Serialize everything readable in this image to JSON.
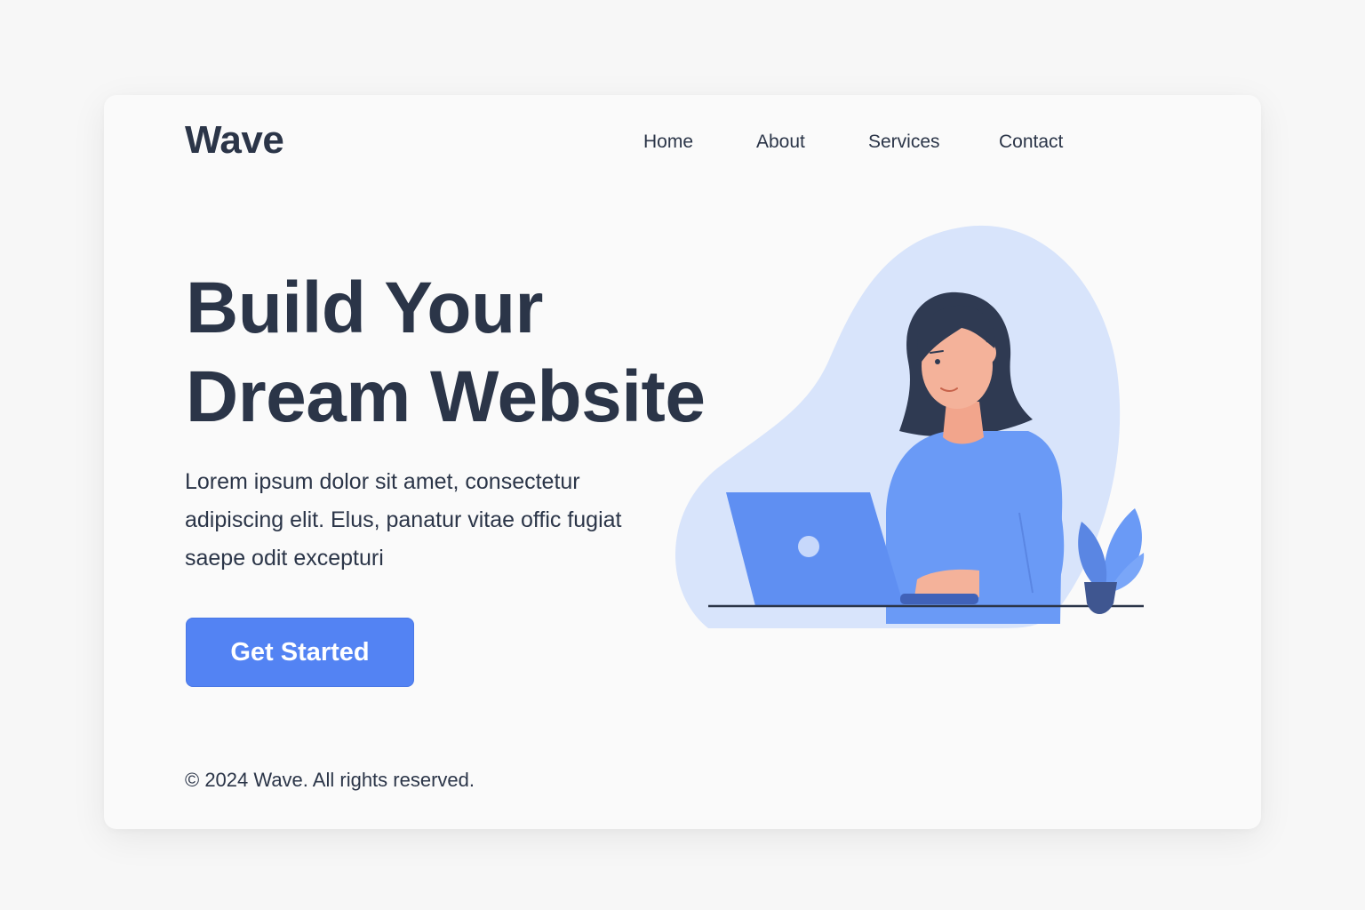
{
  "brand": {
    "name": "Wave"
  },
  "nav": {
    "items": [
      {
        "label": "Home"
      },
      {
        "label": "About"
      },
      {
        "label": "Services"
      },
      {
        "label": "Contact"
      }
    ]
  },
  "hero": {
    "headline_line1": "Build Your",
    "headline_line2": "Dream Website",
    "body": "Lorem ipsum dolor sit amet, consectetur adipiscing elit. Elus, panatur vitae offic fugiat saepe odit excepturi",
    "cta_label": "Get Started"
  },
  "footer": {
    "text": "© 2024 Wave. All rights reserved."
  },
  "colors": {
    "accent": "#5383f3",
    "text": "#2b3548",
    "blob": "#d8e4fb",
    "shirt": "#6a9af6"
  },
  "illustration": {
    "icons": [
      "woman-at-laptop",
      "laptop-icon",
      "plant-icon"
    ]
  }
}
